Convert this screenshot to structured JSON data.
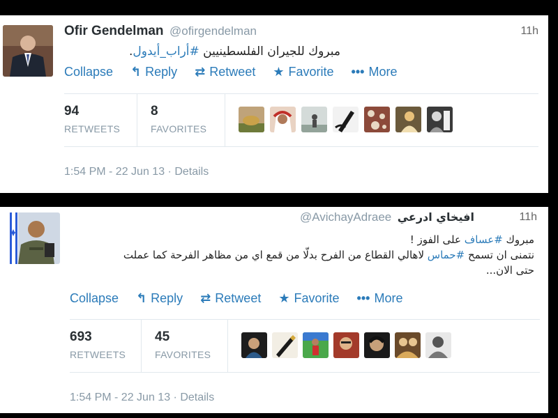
{
  "tweets": [
    {
      "name": "Ofir Gendelman",
      "handle": "@ofirgendelman",
      "time": "11h",
      "text_plain": "مبروك للجيران الفلسطينيين ",
      "text_hashtag": "#أراب_أيدول",
      "text_end": ".",
      "actions": {
        "collapse": "Collapse",
        "reply": "Reply",
        "retweet": "Retweet",
        "favorite": "Favorite",
        "more": "More"
      },
      "retweets_count": "94",
      "retweets_label": "RETWEETS",
      "favorites_count": "8",
      "favorites_label": "FAVORITES",
      "timestamp": "1:54 PM - 22 Jun 13",
      "separator": " · ",
      "details": "Details"
    },
    {
      "name": "افيخاي ادرعي",
      "handle": "@AvichayAdraee",
      "time": "11h",
      "line1_start": "مبروك ",
      "line1_hashtag": "#عساف",
      "line1_end": " على الفوز !",
      "line2_start": "نتمنى ان تسمح ",
      "line2_hashtag": "#حماس",
      "line2_end": " لاهالي القطاع من الفرح بدلّا من قمع اي من مظاهر الفرحة كما عملت",
      "line3": "حتى الان...",
      "actions": {
        "collapse": "Collapse",
        "reply": "Reply",
        "retweet": "Retweet",
        "favorite": "Favorite",
        "more": "More"
      },
      "retweets_count": "693",
      "retweets_label": "RETWEETS",
      "favorites_count": "45",
      "favorites_label": "FAVORITES",
      "timestamp": "1:54 PM - 22 Jun 13",
      "separator": " · ",
      "details": "Details"
    }
  ],
  "icons": {
    "reply": "reply-arrow-icon",
    "retweet": "retweet-icon",
    "favorite": "star-icon",
    "more": "ellipsis-icon"
  },
  "colors": {
    "link": "#2b7bb9",
    "name": "#292f33",
    "muted": "#8899a6",
    "divider": "#e1e8ed",
    "background": "#000000"
  }
}
